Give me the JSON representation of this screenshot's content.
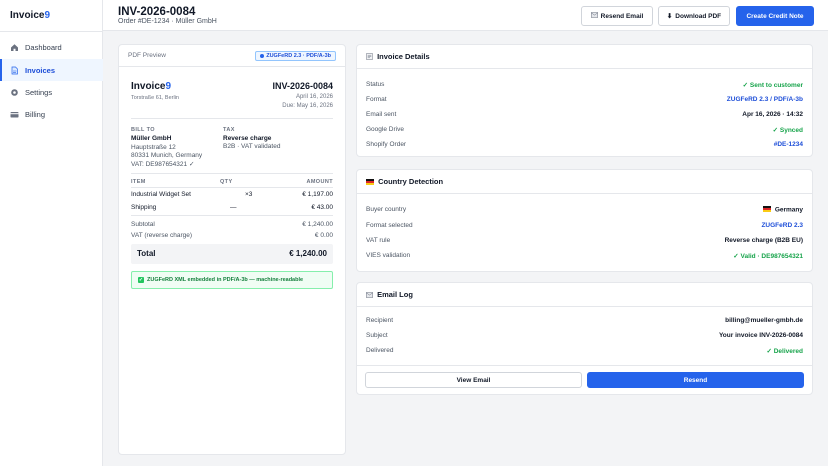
{
  "app": {
    "logo_main": "Invoice",
    "logo_accent": "9"
  },
  "sidebar": {
    "items": [
      {
        "label": "Dashboard",
        "icon": "home-icon"
      },
      {
        "label": "Invoices",
        "icon": "document-icon",
        "active": true
      },
      {
        "label": "Settings",
        "icon": "gear-icon"
      },
      {
        "label": "Billing",
        "icon": "card-icon"
      }
    ]
  },
  "header": {
    "title": "INV-2026-0084",
    "subtitle": "Order #DE-1234 · Müller GmbH",
    "resend_label": "Resend Email",
    "download_label": "Download PDF",
    "credit_label": "Create Credit Note"
  },
  "pdf": {
    "label": "PDF Preview",
    "badge": "ZUGFeRD 2.3 · PDF/A-3b",
    "logo_main": "Invoice",
    "logo_accent": "9",
    "address": "Torstraße 61, Berlin",
    "number": "INV-2026-0084",
    "date": "April 16, 2026",
    "due": "Due: May 16, 2026",
    "bill_to_label": "BILL TO",
    "bill_name": "Müller GmbH",
    "bill_street": "Hauptstraße 12",
    "bill_city": "80331 Munich, Germany",
    "bill_vat": "VAT: DE987654321 ✓",
    "tax_label": "TAX",
    "tax_title": "Reverse charge",
    "tax_sub": "B2B · VAT validated",
    "col_item": "ITEM",
    "col_qty": "QTY",
    "col_amount": "AMOUNT",
    "lines": [
      {
        "item": "Industrial Widget Set",
        "qty": "×3",
        "amount": "€ 1,197.00"
      },
      {
        "item": "Shipping",
        "qty": "—",
        "amount": "€ 43.00"
      }
    ],
    "subtotal_label": "Subtotal",
    "subtotal": "€ 1,240.00",
    "vat_label": "VAT (reverse charge)",
    "vat": "€ 0.00",
    "total_label": "Total",
    "total": "€ 1,240.00",
    "note": "ZUGFeRD XML embedded in PDF/A-3b — machine-readable"
  },
  "details": {
    "title": "Invoice Details",
    "rows": [
      {
        "k": "Status",
        "v": "✓ Sent to customer"
      },
      {
        "k": "Format",
        "v": "ZUGFeRD 2.3 / PDF/A-3b"
      },
      {
        "k": "Email sent",
        "v": "Apr 16, 2026 · 14:32"
      },
      {
        "k": "Google Drive",
        "v": "✓ Synced"
      },
      {
        "k": "Shopify Order",
        "v": "#DE-1234"
      }
    ]
  },
  "country": {
    "title": "Country Detection",
    "rows": [
      {
        "k": "Buyer country",
        "v": "Germany"
      },
      {
        "k": "Format selected",
        "v": "ZUGFeRD 2.3"
      },
      {
        "k": "VAT rule",
        "v": "Reverse charge (B2B EU)"
      },
      {
        "k": "VIES validation",
        "v": "✓ Valid · DE987654321"
      }
    ]
  },
  "email": {
    "title": "Email Log",
    "rows": [
      {
        "k": "Recipient",
        "v": "billing@mueller-gmbh.de"
      },
      {
        "k": "Subject",
        "v": "Your invoice INV-2026-0084"
      },
      {
        "k": "Delivered",
        "v": "✓ Delivered"
      }
    ],
    "view_label": "View Email",
    "resend_label": "Resend"
  },
  "colors": {
    "accent": "#2563eb",
    "success": "#16a34a",
    "link": "#1d4ed8"
  }
}
